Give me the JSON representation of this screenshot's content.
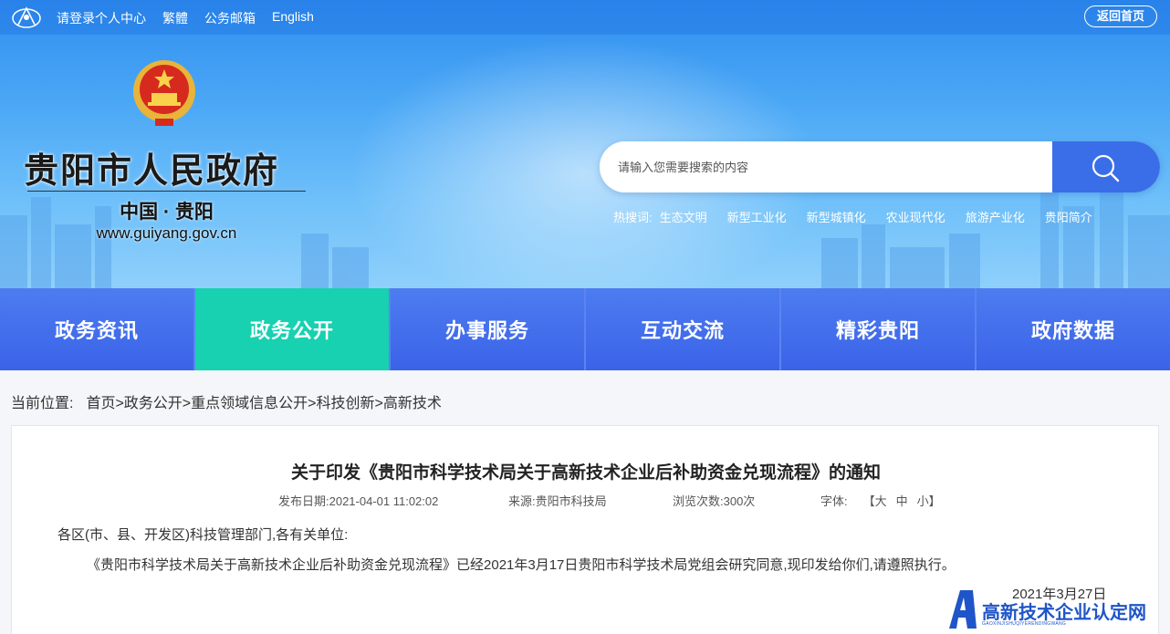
{
  "topbar": {
    "links": [
      "请登录",
      "个人中心",
      "繁體",
      "公务邮箱",
      "English"
    ],
    "home_button": "返回首页"
  },
  "branding": {
    "title": "贵阳市人民政府",
    "subtitle": "中国 · 贵阳",
    "url": "www.guiyang.gov.cn"
  },
  "search": {
    "placeholder": "请输入您需要搜索的内容"
  },
  "hotwords": {
    "label": "热搜词:",
    "items": [
      "生态文明",
      "新型工业化",
      "新型城镇化",
      "农业现代化",
      "旅游产业化",
      "贵阳简介"
    ]
  },
  "nav": {
    "items": [
      "政务资讯",
      "政务公开",
      "办事服务",
      "互动交流",
      "精彩贵阳",
      "政府数据"
    ],
    "active_index": 1
  },
  "breadcrumb": {
    "label": "当前位置:",
    "path": "首页>政务公开>重点领域信息公开>科技创新>高新技术"
  },
  "article": {
    "title": "关于印发《贵阳市科学技术局关于高新技术企业后补助资金兑现流程》的通知",
    "publish_date": "发布日期:2021-04-01 11:02:02",
    "source": "来源:贵阳市科技局",
    "views": "浏览次数:300次",
    "font_label": "字体:",
    "font_open": "【大",
    "font_mid": "中",
    "font_close": "小】",
    "salutation": "各区(市、县、开发区)科技管理部门,各有关单位:",
    "body": "《贵阳市科学技术局关于高新技术企业后补助资金兑现流程》已经2021年3月17日贵阳市科学技术局党组会研究同意,现印发给你们,请遵照执行。",
    "date": "2021年3月27日"
  },
  "watermark": {
    "text": "高新技术企业认定网",
    "sub": "GAOXINJISHUQIYERENDINGWANG"
  },
  "colors": {
    "nav_blue": "#3a63e8",
    "nav_active": "#17d1b0",
    "search_button": "#3a6ee8"
  }
}
